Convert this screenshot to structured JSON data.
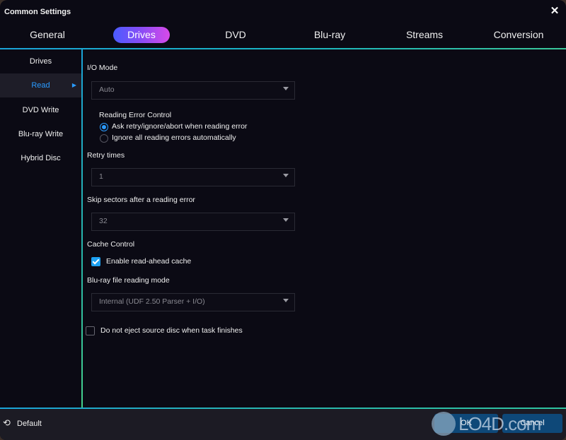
{
  "window": {
    "title": "Common Settings",
    "close_icon": "close-icon"
  },
  "tabs": [
    {
      "label": "General",
      "active": false
    },
    {
      "label": "Drives",
      "active": true
    },
    {
      "label": "DVD",
      "active": false
    },
    {
      "label": "Blu-ray",
      "active": false
    },
    {
      "label": "Streams",
      "active": false
    },
    {
      "label": "Conversion",
      "active": false
    }
  ],
  "sidebar": {
    "items": [
      {
        "label": "Drives",
        "active": false
      },
      {
        "label": "Read",
        "active": true,
        "icon": "caret-right-icon"
      },
      {
        "label": "DVD Write",
        "active": false
      },
      {
        "label": "Blu-ray Write",
        "active": false
      },
      {
        "label": "Hybrid Disc",
        "active": false
      }
    ]
  },
  "read": {
    "io_mode": {
      "label": "I/O Mode",
      "value": "Auto"
    },
    "reading_error_control": {
      "label": "Reading Error Control",
      "options": [
        {
          "label": "Ask retry/ignore/abort when reading error",
          "selected": true
        },
        {
          "label": "Ignore all reading errors automatically",
          "selected": false
        }
      ]
    },
    "retry_times": {
      "label": "Retry times",
      "value": "1"
    },
    "skip_sectors": {
      "label": "Skip sectors after a reading error",
      "value": "32"
    },
    "cache_control": {
      "label": "Cache Control",
      "enable_read_ahead": {
        "label": "Enable read-ahead cache",
        "checked": true
      }
    },
    "bluray_mode": {
      "label": "Blu-ray file reading mode",
      "value": "Internal (UDF 2.50 Parser + I/O)"
    },
    "no_eject": {
      "label": "Do not eject source disc when task finishes",
      "checked": false
    }
  },
  "footer": {
    "default_label": "Default",
    "default_icon": "reset-icon",
    "ok_label": "OK",
    "cancel_label": "Cancel"
  },
  "watermark": {
    "text": "LO4D.com"
  },
  "colors": {
    "accent_blue": "#2a9bff",
    "tab_gradient_start": "#4a5cff",
    "tab_gradient_end": "#d84ae8",
    "divider_cyan": "#1aa3d8",
    "button_blue": "#0e4878"
  }
}
